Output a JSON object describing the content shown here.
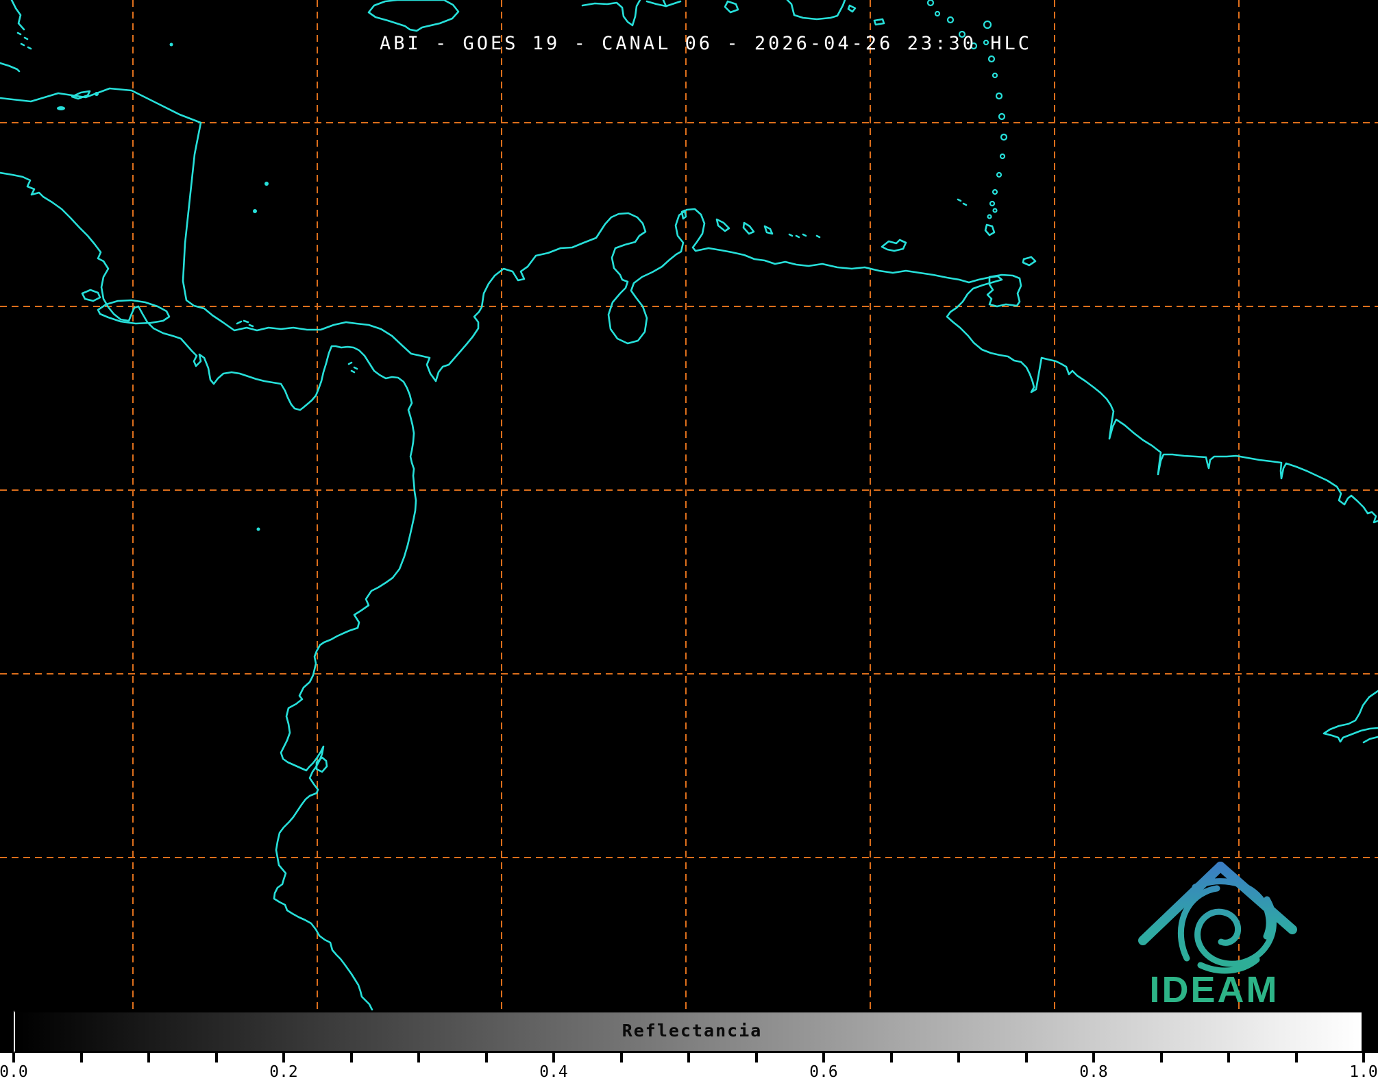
{
  "header": {
    "title": "ABI - GOES 19 - CANAL 06 - 2026-04-26 23:30 HLC"
  },
  "colorbar": {
    "label": "Reflectancia",
    "tick_labels": [
      "0.0",
      "0.2",
      "0.4",
      "0.6",
      "0.8",
      "1.0"
    ],
    "tick_values": [
      0.0,
      0.2,
      0.4,
      0.6,
      0.8,
      1.0
    ],
    "minor_tick_step": 0.05,
    "range_min": 0.0,
    "range_max": 1.0,
    "gradient_start_color": "#000000",
    "gradient_end_color": "#ffffff",
    "strip_background": "#ffffff",
    "text_color": "#000000"
  },
  "logo": {
    "text": "IDEAM",
    "color_top": "#3b7dc4",
    "color_mid": "#2fa9a4",
    "color_bottom": "#2db487",
    "text_color": "#2db487"
  },
  "map": {
    "background_color": "#000000",
    "coastline_color": "#27e0da",
    "grid_color": "#dd6f1c",
    "grid_x_lines": [
      194,
      463,
      732,
      1001,
      1270,
      1539,
      1808
    ],
    "grid_y_lines": [
      179,
      447,
      715,
      983,
      1251
    ],
    "map_area_height": 1474,
    "features": [
      "central-america-caribbean-coast",
      "nicaragua-coast",
      "panama-isthmus",
      "colombia-venezuela-coast",
      "lake-maracaibo",
      "guajira-peninsula",
      "paraguana-peninsula",
      "orinoco-delta",
      "guyana-coast",
      "pacific-coast-central-america",
      "colombia-ecuador-peru-pacific-coast",
      "gulf-of-guayaquil",
      "jamaica",
      "hispaniola-south-coast",
      "lesser-antilles",
      "trinidad",
      "tobago",
      "grenada",
      "aruba",
      "curacao",
      "bonaire",
      "margarita",
      "lake-nicaragua",
      "bay-islands",
      "pearl-islands",
      "amazon-mouth-right-edge"
    ]
  }
}
